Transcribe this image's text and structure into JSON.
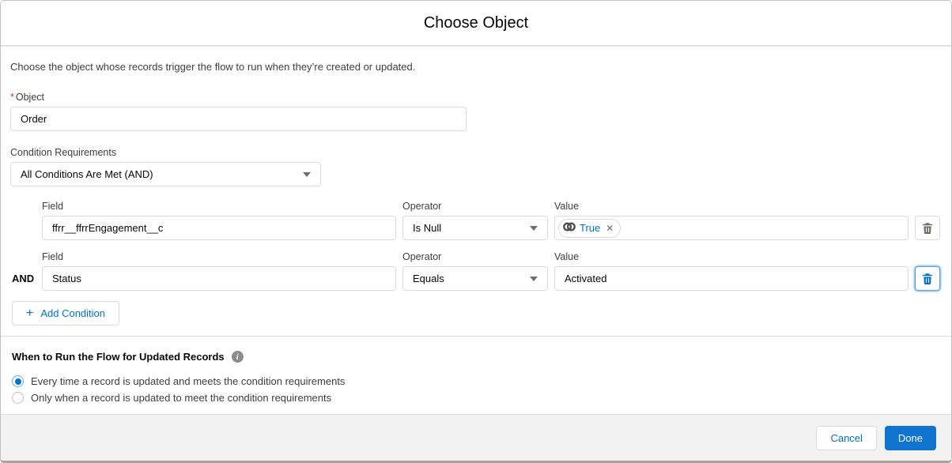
{
  "dialog": {
    "title": "Choose Object",
    "description": "Choose the object whose records trigger the flow to run when they’re created or updated."
  },
  "object_field": {
    "required_marker": "*",
    "label": "Object",
    "value": "Order"
  },
  "condition_requirements": {
    "label": "Condition Requirements",
    "value": "All Conditions Are Met (AND)"
  },
  "conditions": {
    "logic_label": "AND",
    "column_labels": {
      "field": "Field",
      "operator": "Operator",
      "value": "Value"
    },
    "rows": [
      {
        "field": "ffrr__ffrrEngagement__c",
        "operator": "Is Null",
        "value_pill": "True"
      },
      {
        "field": "Status",
        "operator": "Equals",
        "value": "Activated"
      }
    ]
  },
  "add_condition": {
    "label": "Add Condition"
  },
  "when_to_run": {
    "heading": "When to Run the Flow for Updated Records",
    "options": [
      {
        "label": "Every time a record is updated and meets the condition requirements",
        "selected": true
      },
      {
        "label": "Only when a record is updated to meet the condition requirements",
        "selected": false
      }
    ]
  },
  "footer": {
    "cancel_label": "Cancel",
    "done_label": "Done"
  },
  "icons": {
    "plus": "+",
    "close_x": "✕",
    "info_i": "i"
  },
  "colors": {
    "accent": "#0070d2",
    "border": "#dddbda",
    "footer_bg": "#f3f2f2",
    "required": "#c23934",
    "done_button": "#1073cd"
  }
}
